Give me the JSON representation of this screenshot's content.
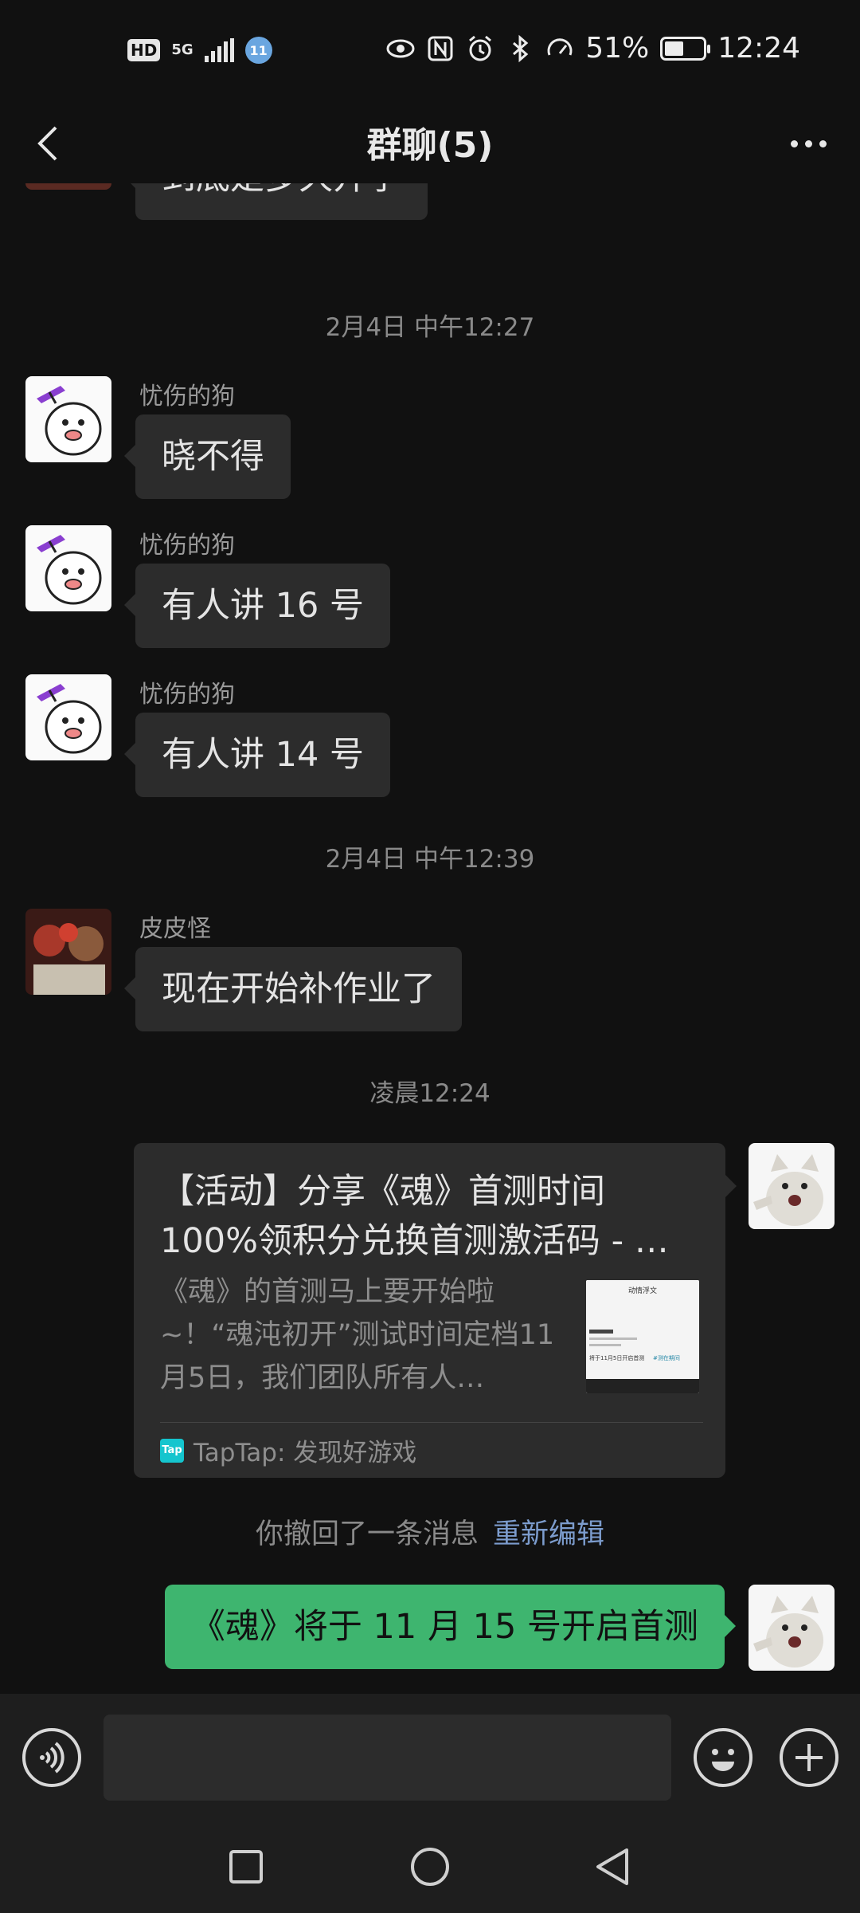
{
  "status_bar": {
    "hd": "HD",
    "network": "5G",
    "battery_percent": "51%",
    "battery_level": 0.51,
    "time": "12:24"
  },
  "header": {
    "title": "群聊(5)",
    "back_icon": "chevron-left-icon",
    "more_icon": "more-horizontal-icon"
  },
  "messages": [
    {
      "type": "text",
      "side": "left",
      "sender": "",
      "text": "到底是多久开学"
    },
    {
      "type": "time",
      "text": "2月4日 中午12:27"
    },
    {
      "type": "text",
      "side": "left",
      "sender": "忧伤的狗",
      "text": "晓不得"
    },
    {
      "type": "text",
      "side": "left",
      "sender": "忧伤的狗",
      "text": "有人讲 16 号"
    },
    {
      "type": "text",
      "side": "left",
      "sender": "忧伤的狗",
      "text": "有人讲 14 号"
    },
    {
      "type": "time",
      "text": "2月4日 中午12:39"
    },
    {
      "type": "text",
      "side": "left",
      "sender": "皮皮怪",
      "text": "现在开始补作业了"
    },
    {
      "type": "time",
      "text": "凌晨12:24"
    },
    {
      "type": "link_card",
      "side": "right",
      "title": "【活动】分享《魂》首测时间100%领积分兑换首测激活码 - …",
      "description": "《魂》的首测马上要开始啦~！“魂沌初开”测试时间定档11月5日，我们团队所有人…",
      "thumb_heading": "动情浮文",
      "thumb_line": "将于11月5日开启首测",
      "thumb_link": "#测在期间",
      "source": "TapTap: 发现好游戏",
      "source_icon_text": "Tap"
    },
    {
      "type": "recall",
      "text": "你撤回了一条消息",
      "action": "重新编辑"
    },
    {
      "type": "text",
      "side": "right",
      "text": "《魂》将于 11 月 15 号开启首测"
    }
  ],
  "input_bar": {
    "voice_icon": "voice-icon",
    "placeholder": "",
    "emoji_icon": "emoji-icon",
    "plus_icon": "plus-icon"
  },
  "nav_bar": {
    "recent_icon": "square-icon",
    "home_icon": "circle-icon",
    "back_icon": "triangle-back-icon"
  },
  "colors": {
    "background": "#111111",
    "bubble": "#2c2c2c",
    "own_bubble": "#3eb56f",
    "link_blue": "#7c9ccd"
  }
}
